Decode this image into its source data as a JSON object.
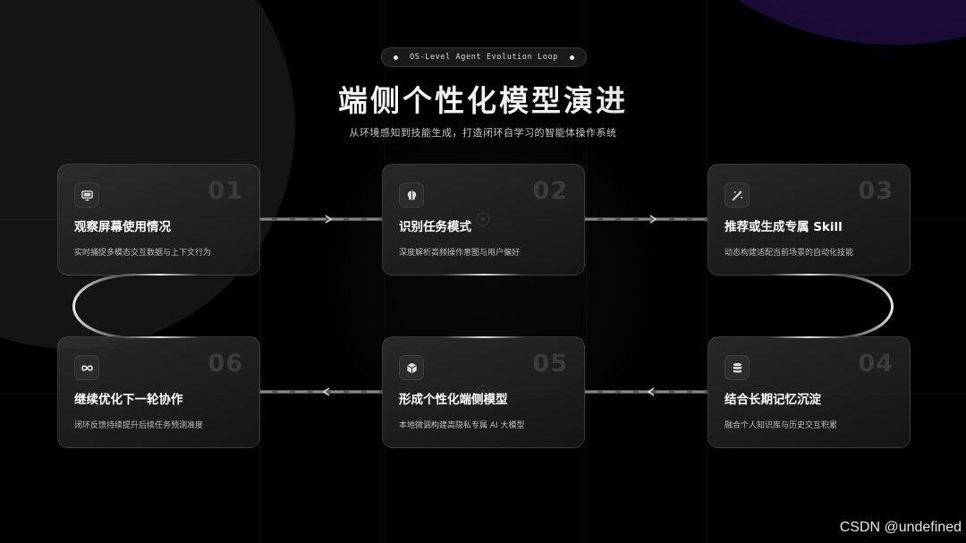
{
  "header": {
    "tag": "OS-Level Agent Evolution Loop",
    "title": "端侧个性化模型演进",
    "subtitle": "从环境感知到技能生成，打造闭环自学习的智能体操作系统"
  },
  "steps": [
    {
      "number": "01",
      "title": "观察屏幕使用情况",
      "desc": "实时捕捉多模态交互数据与上下文行为",
      "icon": "monitor-icon"
    },
    {
      "number": "02",
      "title": "识别任务模式",
      "desc": "深度解析高频操作意图与用户偏好",
      "icon": "brain-icon"
    },
    {
      "number": "03",
      "title": "推荐或生成专属 Skill",
      "desc": "动态构建适配当前场景的自动化技能",
      "icon": "magic-wand-icon"
    },
    {
      "number": "04",
      "title": "结合长期记忆沉淀",
      "desc": "融合个人知识库与历史交互积累",
      "icon": "database-icon"
    },
    {
      "number": "05",
      "title": "形成个性化端侧模型",
      "desc": "本地微调构建高隐私专属 AI 大模型",
      "icon": "cube-icon"
    },
    {
      "number": "06",
      "title": "继续优化下一轮协作",
      "desc": "闭环反馈持续提升后续任务预测准度",
      "icon": "infinity-icon"
    }
  ],
  "watermark": "CSDN @undefined",
  "colors": {
    "background": "#000000",
    "accent_purple": "#2a1456",
    "card_border": "#3a3a3a",
    "number": "#3a3a3a"
  }
}
